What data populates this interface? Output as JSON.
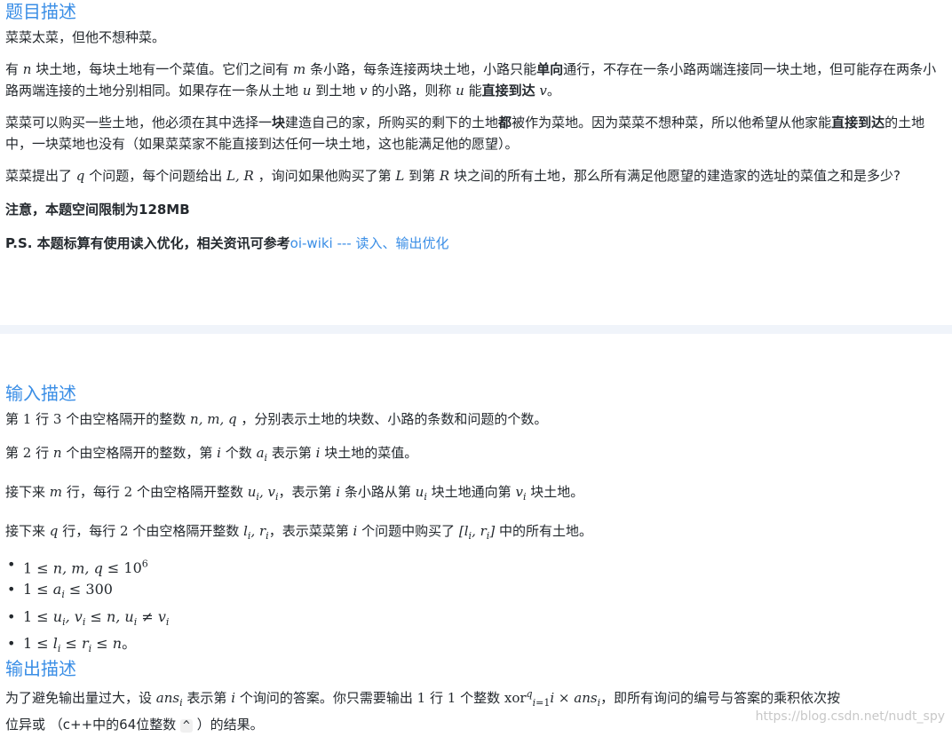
{
  "desc": {
    "title": "题目描述",
    "p1": "菜菜太菜，但他不想种菜。",
    "p2_a": "有",
    "p2_b": "块土地，每块土地有一个菜值。它们之间有",
    "p2_c": "条小路，每条连接两块土地，小路只能",
    "p2_d": "单向",
    "p2_e": "通行，不存在一条小路两端连接同一块土地，但可能存在两条小路两端连接的土地分别相同。如果存在一条从土地",
    "p2_f": "到土地",
    "p2_g": "的小路，则称",
    "p2_h": "能",
    "p2_i": "直接到达",
    "p3_a": "菜菜可以购买一些土地，他必须在其中选择一",
    "p3_b": "块",
    "p3_c": "建造自己的家，所购买的剩下的土地",
    "p3_d": "都",
    "p3_e": "被作为菜地。因为菜菜不想种菜，所以他希望从他家能",
    "p3_f": "直接到达",
    "p3_g": "的土地中，一块菜地也没有（如果菜菜家不能直接到达任何一块土地，这也能满足他的愿望）。",
    "p4_a": "菜菜提出了",
    "p4_b": "个问题，每个问题给出",
    "p4_c": "，询问如果他购买了第",
    "p4_d": "到第",
    "p4_e": "块之间的所有土地，那么所有满足他愿望的建造家的选址的菜值之和是多少?",
    "note": "注意，本题空间限制为128MB",
    "ps_text": "P.S. 本题标算有使用读入优化，相关资讯可参考",
    "ps_link": "oi-wiki --- 读入、输出优化"
  },
  "input": {
    "title": "输入描述",
    "l1_a": "第",
    "l1_b": "行",
    "l1_c": "个由空格隔开的整数",
    "l1_d": "，分别表示土地的块数、小路的条数和问题的个数。",
    "l2_a": "第",
    "l2_b": "行",
    "l2_c": "个由空格隔开的整数，第",
    "l2_d": "个数",
    "l2_e": "表示第",
    "l2_f": "块土地的菜值。",
    "l3_a": "接下来",
    "l3_b": "行，每行",
    "l3_c": "个由空格隔开整数",
    "l3_d": "，表示第",
    "l3_e": "条小路从第",
    "l3_f": "块土地通向第",
    "l3_g": "块土地。",
    "l4_a": "接下来",
    "l4_b": "行，每行",
    "l4_c": "个由空格隔开整数",
    "l4_d": "，表示菜菜第",
    "l4_e": "个问题中购买了",
    "l4_f": "中的所有土地。"
  },
  "output": {
    "title": "输出描述",
    "l1_a": "为了避免输出量过大，设",
    "l1_b": "表示第",
    "l1_c": "个询问的答案。你只需要输出",
    "l1_d": "行",
    "l1_e": "个整数",
    "l1_f": "，即所有询问的编号与答案的乘积依次按",
    "l2_a": "位异或 （c++中的64位整数",
    "l2_code": "^",
    "l2_b": "）的结果。"
  },
  "watermark": "https://blog.csdn.net/nudt_spy"
}
